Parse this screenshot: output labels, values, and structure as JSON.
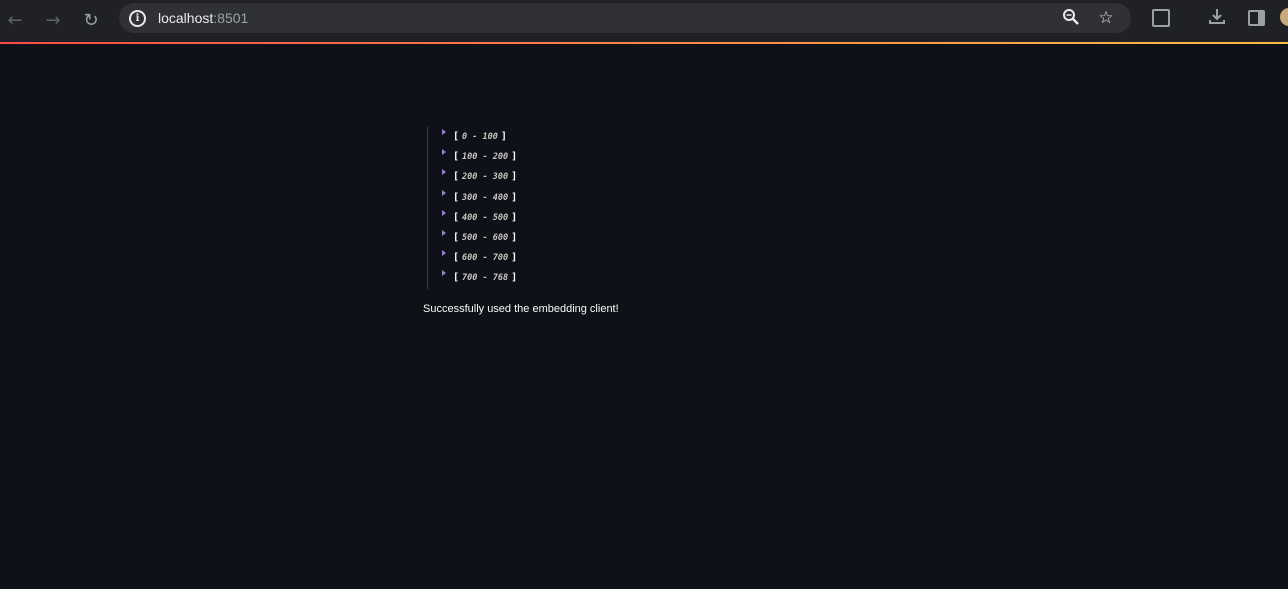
{
  "browser": {
    "url_host": "localhost",
    "url_port": ":8501",
    "back_icon": "arrow-left-icon",
    "forward_icon": "arrow-right-icon",
    "reload_icon": "reload-icon"
  },
  "json_tree": {
    "items": [
      {
        "label": "0 - 100"
      },
      {
        "label": "100 - 200"
      },
      {
        "label": "200 - 300"
      },
      {
        "label": "300 - 400"
      },
      {
        "label": "400 - 500"
      },
      {
        "label": "500 - 600"
      },
      {
        "label": "600 - 700"
      },
      {
        "label": "700 - 768"
      }
    ]
  },
  "message": "Successfully used the embedding client!",
  "colors": {
    "background": "#0e1117",
    "caret": "#9d7bd8",
    "accent_start": "#ff4b4b",
    "accent_end": "#ffbd45"
  }
}
